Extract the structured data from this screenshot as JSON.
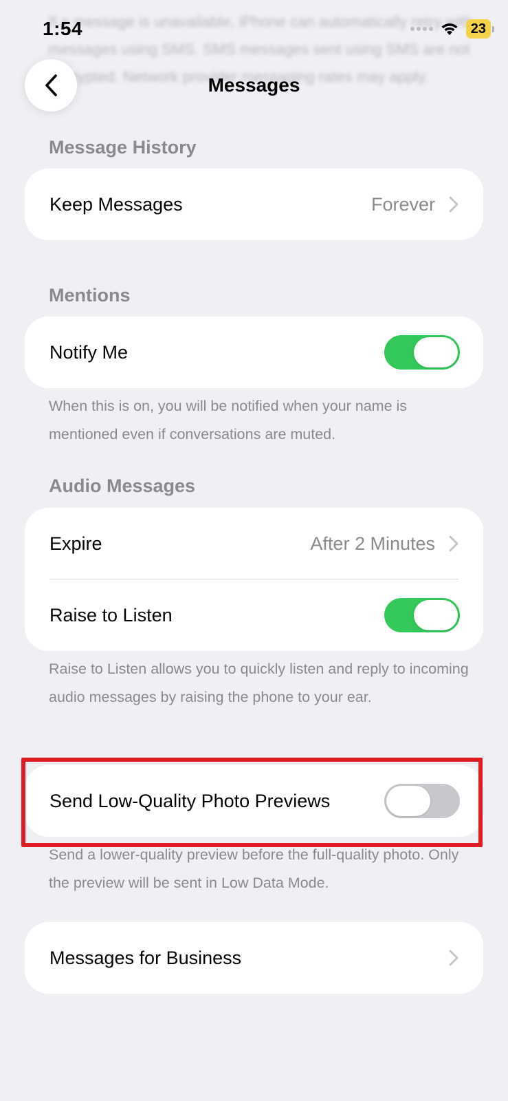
{
  "status_bar": {
    "time": "1:54",
    "battery_level": "23",
    "battery_color": "#f4d24a"
  },
  "background_text": "If a message is unavailable, iPhone can automatically retry with messages using SMS. SMS messages sent using SMS are not encrypted. Network provider messaging rates may apply.",
  "nav": {
    "back_icon": "chevron-left-icon",
    "title": "Messages"
  },
  "sections": {
    "message_history": {
      "header": "Message History",
      "keep_messages": {
        "label": "Keep Messages",
        "value": "Forever"
      }
    },
    "mentions": {
      "header": "Mentions",
      "notify_me": {
        "label": "Notify Me",
        "enabled": true
      },
      "footer": "When this is on, you will be notified when your name is mentioned even if conversations are muted."
    },
    "audio_messages": {
      "header": "Audio Messages",
      "expire": {
        "label": "Expire",
        "value": "After 2 Minutes"
      },
      "raise_to_listen": {
        "label": "Raise to Listen",
        "enabled": true
      },
      "footer": "Raise to Listen allows you to quickly listen and reply to incoming audio messages by raising the phone to your ear."
    },
    "photo_previews": {
      "send_low_quality": {
        "label": "Send Low-Quality Photo Previews",
        "enabled": false
      },
      "footer": "Send a lower-quality preview before the full-quality photo. Only the preview will be sent in Low Data Mode."
    },
    "business": {
      "messages_for_business": {
        "label": "Messages for Business"
      }
    }
  },
  "colors": {
    "toggle_on": "#34c759",
    "toggle_off": "#c7c7cc",
    "highlight": "#e01b24",
    "secondary_text": "#8a8a8e"
  }
}
